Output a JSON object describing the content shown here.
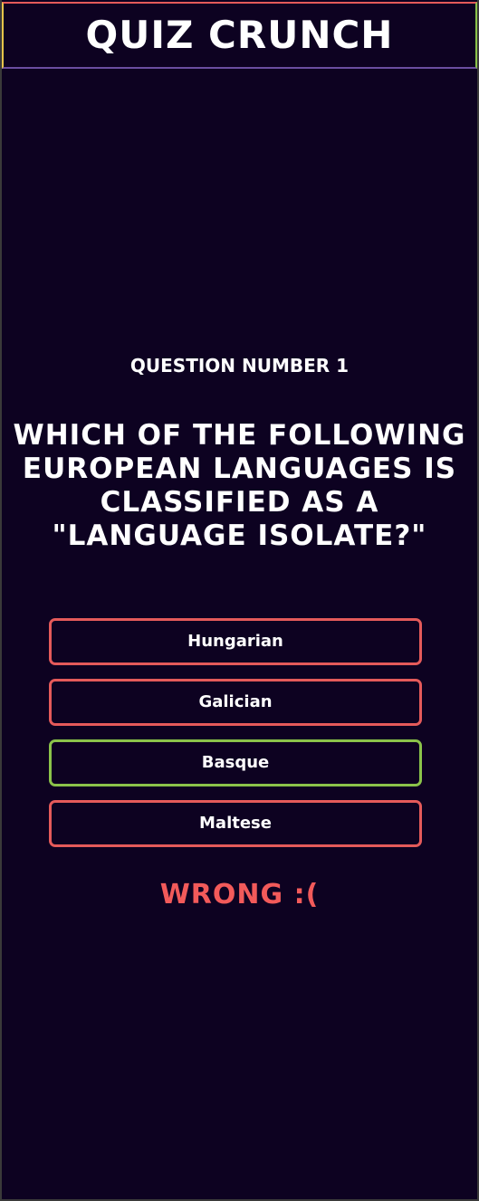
{
  "app": {
    "title": "Quiz Crunch"
  },
  "quiz": {
    "question_number_label": "Question Number 1",
    "question": "Which of the following European languages is classified as a \"language isolate?\"",
    "answers": [
      {
        "label": "Hungarian",
        "state": "wrong"
      },
      {
        "label": "Galician",
        "state": "wrong"
      },
      {
        "label": "Basque",
        "state": "correct"
      },
      {
        "label": "Maltese",
        "state": "wrong"
      }
    ],
    "result": "Wrong :("
  },
  "colors": {
    "background": "#0d0221",
    "wrong_border": "#e45a5a",
    "correct_border": "#8bc34a",
    "result_text": "#f25a5a",
    "text": "#ffffff"
  }
}
